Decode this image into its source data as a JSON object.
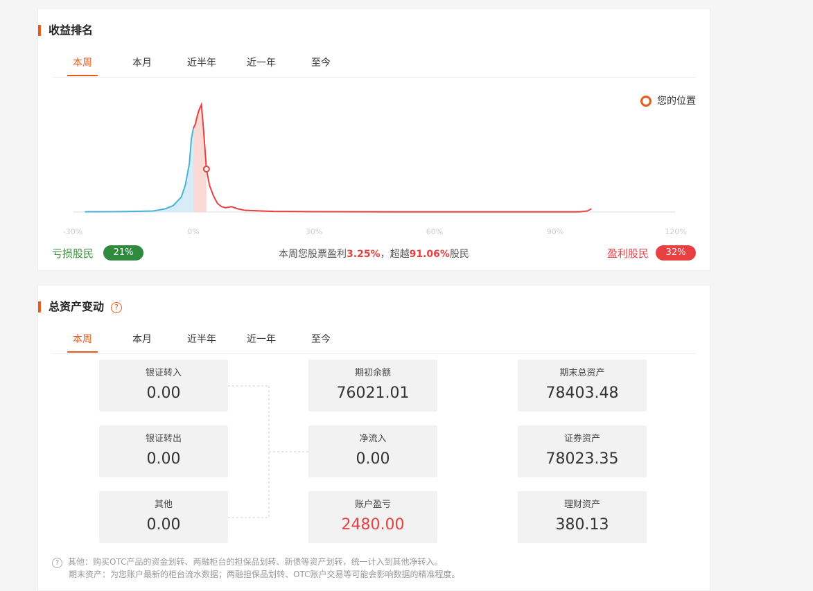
{
  "rank_section": {
    "title": "收益排名",
    "tabs": [
      "本周",
      "本月",
      "近半年",
      "近一年",
      "至今"
    ],
    "active_tab": 0,
    "legend_label": "您的位置",
    "loss_label": "亏损股民",
    "loss_pct": "21%",
    "gain_label": "盈利股民",
    "gain_pct": "32%",
    "summary_prefix": "本周您股票盈利",
    "summary_return": "3.25%",
    "summary_mid": "，超越",
    "summary_rank": "91.06%",
    "summary_suffix": "股民"
  },
  "chart_data": {
    "type": "area",
    "x_ticks": [
      "-30%",
      "0%",
      "30%",
      "60%",
      "90%",
      "120%"
    ],
    "xlim": [
      -30,
      120
    ],
    "your_position": {
      "x": 3.25
    },
    "colors": {
      "loss": "#4ab3d6",
      "gain": "#e84040",
      "loss_fill": "#d6ecf7",
      "gain_fill": "#fbd9d4",
      "marker": "#e84040"
    },
    "series": [
      {
        "values": [
          [
            -27,
            0.002
          ],
          [
            -20,
            0.003
          ],
          [
            -15,
            0.006
          ],
          [
            -10,
            0.01
          ],
          [
            -7,
            0.03
          ],
          [
            -5,
            0.06
          ],
          [
            -3,
            0.14
          ],
          [
            -2,
            0.25
          ],
          [
            -1,
            0.45
          ],
          [
            -0.5,
            0.68
          ],
          [
            0,
            0.78
          ],
          [
            0.5,
            0.82
          ],
          [
            1,
            0.9
          ],
          [
            1.5,
            0.96
          ],
          [
            2.0,
            1.0
          ],
          [
            2.5,
            0.78
          ],
          [
            3.25,
            0.4
          ],
          [
            4,
            0.25
          ],
          [
            5,
            0.15
          ],
          [
            6,
            0.08
          ],
          [
            7,
            0.05
          ],
          [
            8,
            0.04
          ],
          [
            9.5,
            0.05
          ],
          [
            11,
            0.03
          ],
          [
            13,
            0.015
          ],
          [
            20,
            0.006
          ],
          [
            30,
            0.003
          ],
          [
            50,
            0.002
          ],
          [
            70,
            0.002
          ],
          [
            96,
            0.002
          ],
          [
            98,
            0.01
          ],
          [
            99,
            0.03
          ]
        ]
      }
    ]
  },
  "asset_section": {
    "title": "总资产变动",
    "help": "?",
    "tabs": [
      "本周",
      "本月",
      "近半年",
      "近一年",
      "至今"
    ],
    "active_tab": 0,
    "boxes": {
      "bank_in": {
        "label": "银证转入",
        "value": "0.00"
      },
      "bank_out": {
        "label": "银证转出",
        "value": "0.00"
      },
      "other": {
        "label": "其他",
        "value": "0.00"
      },
      "opening": {
        "label": "期初余额",
        "value": "76021.01"
      },
      "net_inflow": {
        "label": "净流入",
        "value": "0.00"
      },
      "pnl": {
        "label": "账户盈亏",
        "value": "2480.00"
      },
      "ending_total": {
        "label": "期末总资产",
        "value": "78403.48"
      },
      "securities": {
        "label": "证券资产",
        "value": "78023.35"
      },
      "wealth": {
        "label": "理财资产",
        "value": "380.13"
      }
    },
    "note_line1": "其他：购买OTC产品的资金划转、两融柜台的担保品划转、新债等资产划转，统一计入到其他净转入。",
    "note_line2": "期末资产：为您账户最新的柜台流水数据；两融担保品划转、OTC账户交易等可能会影响数据的精准程度。"
  }
}
